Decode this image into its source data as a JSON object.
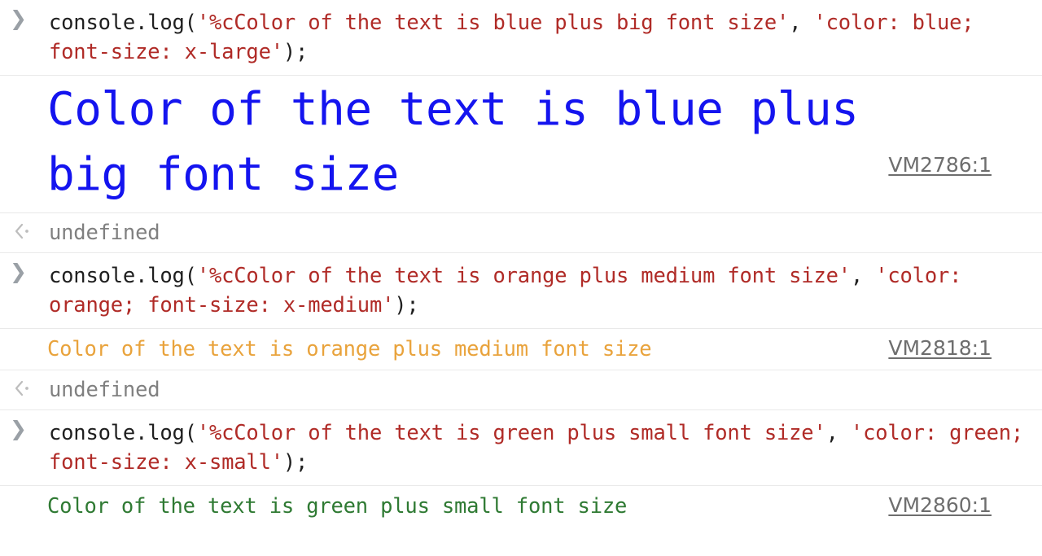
{
  "console": {
    "prompt_icon": "chevron-right-icon",
    "result_icon": "chevron-left-dot-icon",
    "colors": {
      "code_text": "#1f1f1f",
      "code_string": "#b02b27",
      "blue_output": "#1414ef",
      "orange_output": "#e9a33c",
      "green_output": "#2f7a33",
      "link": "#6e6e6e",
      "result_text": "#808080",
      "divider": "#e9e9e9",
      "background": "#ffffff"
    },
    "entries": [
      {
        "type": "input",
        "code_parts": [
          {
            "kind": "plain",
            "text": "console.log("
          },
          {
            "kind": "string",
            "text": "'%cColor of the text is blue plus big font size'"
          },
          {
            "kind": "plain",
            "text": ", "
          },
          {
            "kind": "string",
            "text": "'color: blue; font-size: x-large'"
          },
          {
            "kind": "plain",
            "text": ");"
          }
        ],
        "full_code": "console.log('%cColor of the text is blue plus big font size', 'color: blue; font-size: x-large');"
      },
      {
        "type": "output",
        "style": "blue",
        "text": "Color of the text is blue plus big font size",
        "source_link": "VM2786:1"
      },
      {
        "type": "result",
        "value": "undefined"
      },
      {
        "type": "input",
        "code_parts": [
          {
            "kind": "plain",
            "text": "console.log("
          },
          {
            "kind": "string",
            "text": "'%cColor of the text is orange plus medium font size'"
          },
          {
            "kind": "plain",
            "text": ", "
          },
          {
            "kind": "string",
            "text": "'color: orange; font-size: x-medium'"
          },
          {
            "kind": "plain",
            "text": ");"
          }
        ],
        "full_code": "console.log('%cColor of the text is orange plus medium font size', 'color: orange; font-size: x-medium');"
      },
      {
        "type": "output",
        "style": "orange",
        "text": "Color of the text is orange plus medium font size",
        "source_link": "VM2818:1"
      },
      {
        "type": "result",
        "value": "undefined"
      },
      {
        "type": "input",
        "code_parts": [
          {
            "kind": "plain",
            "text": "console.log("
          },
          {
            "kind": "string",
            "text": "'%cColor of the text is green plus small font size'"
          },
          {
            "kind": "plain",
            "text": ", "
          },
          {
            "kind": "string",
            "text": "'color: green; font-size: x-small'"
          },
          {
            "kind": "plain",
            "text": ");"
          }
        ],
        "full_code": "console.log('%cColor of the text is green plus small font size', 'color: green; font-size: x-small');"
      },
      {
        "type": "output",
        "style": "green",
        "text": "Color of the text is green plus small font size",
        "source_link": "VM2860:1"
      }
    ]
  }
}
